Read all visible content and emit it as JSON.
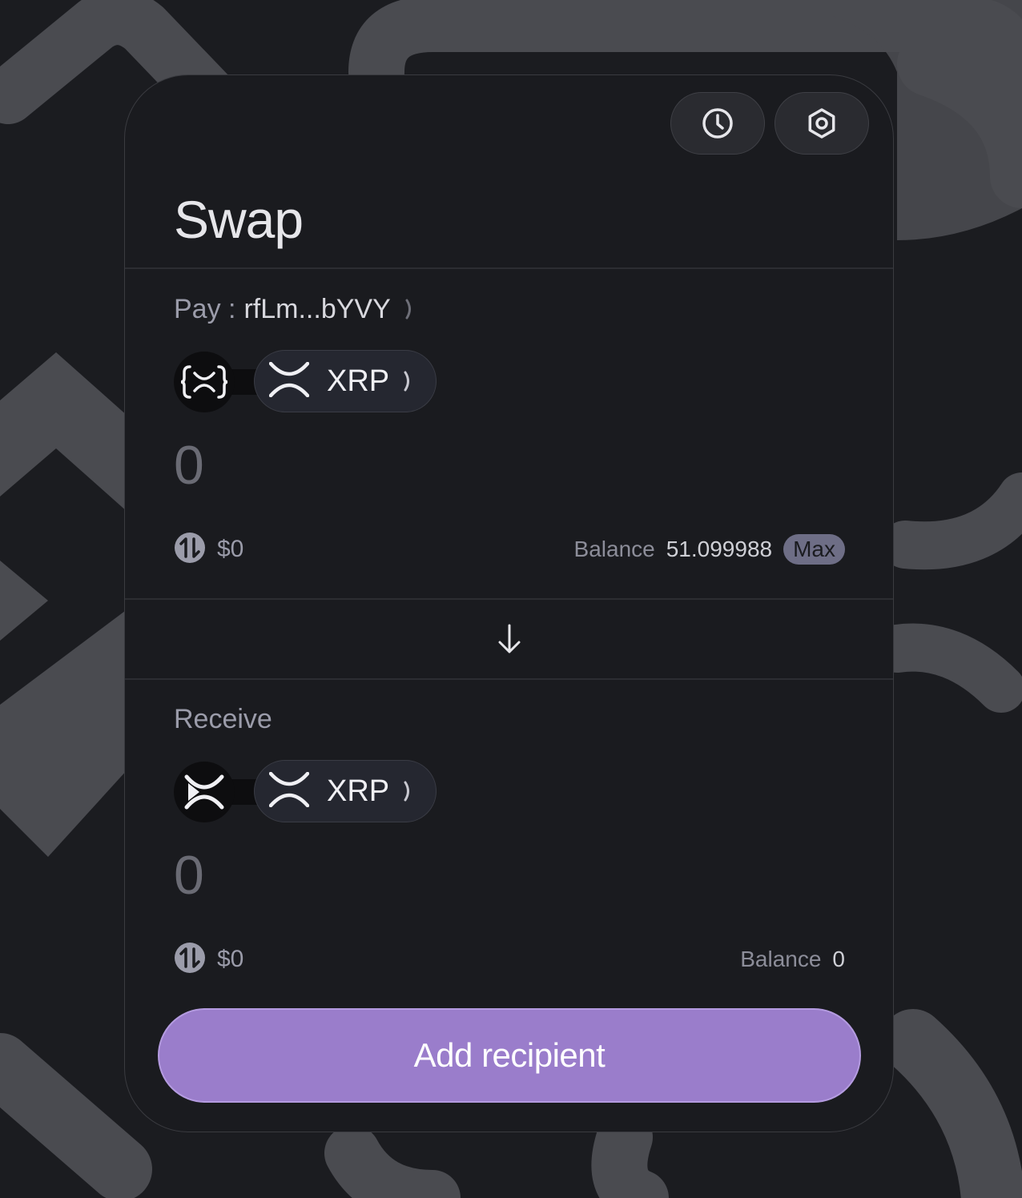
{
  "header": {
    "title": "Swap",
    "history_icon": "clock-icon",
    "settings_icon": "gear-icon"
  },
  "pay": {
    "label": "Pay :",
    "account": "rfLm...bYVY",
    "chain_icon": "x-bracket-icon",
    "token": "XRP",
    "token_icon": "xrp-icon",
    "amount_placeholder": "0",
    "usd_value": "$0",
    "balance_label": "Balance",
    "balance_value": "51.099988",
    "max_label": "Max"
  },
  "switch_icon": "arrow-down-icon",
  "receive": {
    "label": "Receive",
    "chain_icon": "xrp-icon",
    "token": "XRP",
    "token_icon": "xrp-icon",
    "amount_placeholder": "0",
    "usd_value": "$0",
    "balance_label": "Balance",
    "balance_value": "0"
  },
  "cta": {
    "label": "Add recipient"
  },
  "colors": {
    "accent": "#9a7dcb",
    "background": "#1b1c20",
    "card": "#1a1b1f"
  }
}
